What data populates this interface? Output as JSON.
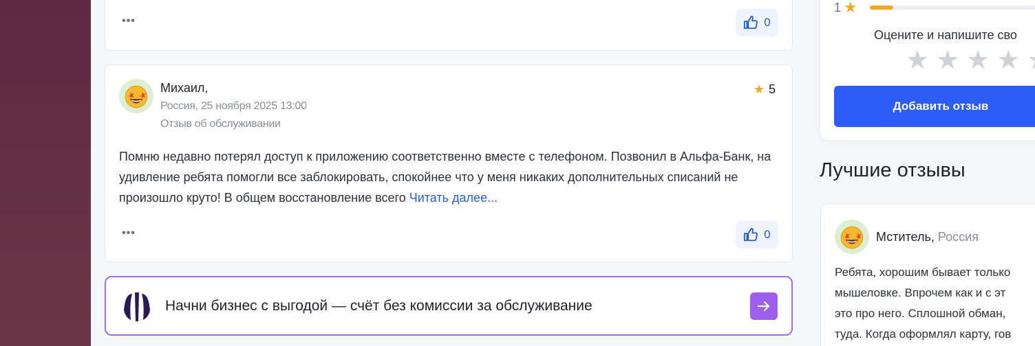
{
  "previous_review": {
    "more_label": "•••",
    "likes": "0"
  },
  "review": {
    "author": "Михаил,",
    "meta_line": "Россия, 25 ноября 2025 13:00",
    "type": "Отзыв об обслуживании",
    "rating": "5",
    "text": "Помню недавно потерял доступ к приложению соответственно вместе с телефоном. Позвонил в Альфа-Банк, на удивление ребята помогли все заблокировать, спокойнее что у меня никаких дополнительных списаний не произошло круто! В общем восстановление всего ",
    "read_more": "Читать далее...",
    "more_label": "•••",
    "likes": "0"
  },
  "promo": {
    "text": "Начни бизнес с выгодой — счёт без комиссии за обслуживание"
  },
  "sidebar": {
    "one_star_label": "1",
    "one_star_fraction": 0.12,
    "rate_prompt": "Оцените и напишите сво",
    "add_review_button": "Добавить отзыв",
    "best_reviews_title": "Лучшие отзывы",
    "best_review": {
      "author": "Мститель",
      "country": "Россия",
      "lines": [
        "Ребята, хорошим бывает только",
        "мышеловке. Впрочем как и с эт",
        "это про него. Сплошной обман,",
        "туда. Когда оформлял карту, гов"
      ]
    }
  },
  "colors": {
    "accent_blue": "#2d5cf6",
    "star": "#f5a623",
    "promo_border": "#9b6cf0",
    "left_strip": "#653245"
  },
  "icons": [
    "thumb-up-icon",
    "star-icon",
    "emoji-avatar-icon",
    "alfa-logo-icon",
    "arrow-right-icon"
  ]
}
